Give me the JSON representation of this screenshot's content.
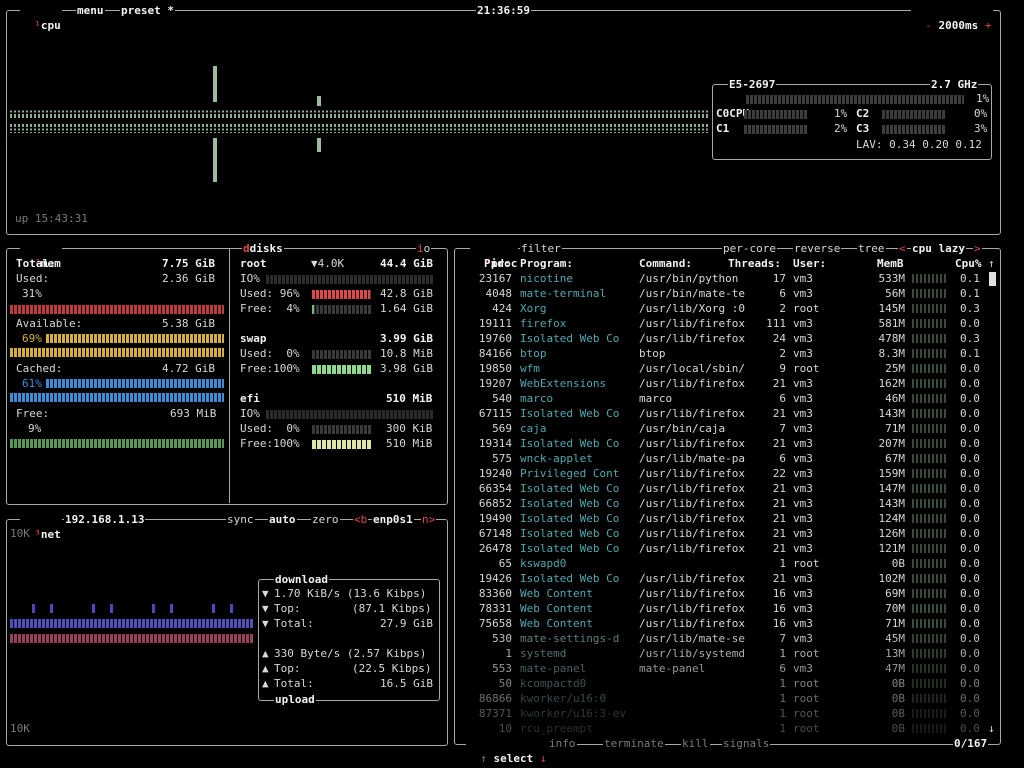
{
  "cpu_panel": {
    "tab_num": "¹",
    "label": "cpu",
    "menu": "menu",
    "preset": "preset *",
    "clock": "21:36:59",
    "interval": "2000ms",
    "minus": "-",
    "plus": "+",
    "uptime": "up 15:43:31",
    "model": "E5-2697",
    "freq": "2.7 GHz",
    "cpu_label": "CPU",
    "cpu_pct": "1%",
    "cores": [
      {
        "name": "C0",
        "pct": "1%"
      },
      {
        "name": "C2",
        "pct": "0%"
      },
      {
        "name": "C1",
        "pct": "2%"
      },
      {
        "name": "C3",
        "pct": "3%"
      }
    ],
    "load_avg": "LAV: 0.34 0.20 0.12"
  },
  "mem_panel": {
    "tab_num": "²",
    "label": "mem",
    "total_label": "Total:",
    "total_value": "7.75 GiB",
    "used_label": "Used:",
    "used_value": "2.36 GiB",
    "used_pct": "31%",
    "avail_label": "Available:",
    "avail_value": "5.38 GiB",
    "avail_pct": "69%",
    "cached_label": "Cached:",
    "cached_value": "4.72 GiB",
    "cached_pct": "61%",
    "free_label": "Free:",
    "free_value": "693 MiB",
    "free_pct": "9%",
    "colors": {
      "used": "#e04848",
      "available": "#d8b040",
      "cached": "#3c8ed8",
      "free": "#6cbf6c"
    }
  },
  "disks_panel": {
    "label": "disks",
    "io_label": "io",
    "disks": [
      {
        "name": "root",
        "io_rate": "▼4.0K",
        "size": "44.4 GiB",
        "io_line": "IO%",
        "used_line": "Used: 96%",
        "used_value": "42.8 GiB",
        "used_fraction": 0.96,
        "free_line": "Free:  4%",
        "free_value": "1.64 GiB",
        "free_fraction": 0.04
      },
      {
        "name": "swap",
        "size": "3.99 GiB",
        "used_line": "Used:  0%",
        "used_value": "10.8 MiB",
        "used_fraction": 0.0,
        "free_line": "Free:100%",
        "free_value": "3.98 GiB",
        "free_fraction": 1.0
      },
      {
        "name": "efi",
        "size": "510 MiB",
        "io_line": "IO%",
        "used_line": "Used:  0%",
        "used_value": "300 KiB",
        "used_fraction": 0.0,
        "free_line": "Free:100%",
        "free_value": "510 MiB",
        "free_fraction": 1.0
      }
    ]
  },
  "net_panel": {
    "tab_num": "³",
    "label": "net",
    "ip": "192.168.1.13",
    "sync": "sync",
    "auto": "auto",
    "zero": "zero",
    "prev": "<b",
    "iface": "enp0s1",
    "next": "n>",
    "scale_top": "10K",
    "scale_bottom": "10K",
    "download_title": "download",
    "upload_title": "upload",
    "download": [
      {
        "arrow": "▼",
        "label": "",
        "value": "1.70 KiB/s (13.6 Kibps)"
      },
      {
        "arrow": "▼",
        "label": "Top:",
        "value": "(87.1 Kibps)"
      },
      {
        "arrow": "▼",
        "label": "Total:",
        "value": "27.9 GiB"
      }
    ],
    "upload": [
      {
        "arrow": "▲",
        "label": "",
        "value": "330 Byte/s (2.57 Kibps)"
      },
      {
        "arrow": "▲",
        "label": "Top:",
        "value": "(22.5 Kibps)"
      },
      {
        "arrow": "▲",
        "label": "Total:",
        "value": "16.5 GiB"
      }
    ]
  },
  "proc_panel": {
    "tab_num": "⁴",
    "label": "proc",
    "filter": "filter",
    "per_core": "per-core",
    "reverse": "reverse",
    "tree": "tree",
    "sort_left": "<",
    "sort_by": "cpu lazy",
    "sort_right": ">",
    "headers": {
      "pid": "Pid:",
      "program": "Program:",
      "command": "Command:",
      "threads": "Threads:",
      "user": "User:",
      "mem": "MemB",
      "cpu": "Cpu%"
    },
    "select": "select",
    "info": "info",
    "terminate": "terminate",
    "kill": "kill",
    "signals": "signals",
    "count": "0/167",
    "rows": [
      {
        "pid": "23167",
        "program": "nicotine",
        "command": "/usr/bin/python",
        "threads": "17",
        "user": "vm3",
        "mem": "533M",
        "cpu": "0.1"
      },
      {
        "pid": "4048",
        "program": "mate-terminal",
        "command": "/usr/bin/mate-te",
        "threads": "6",
        "user": "vm3",
        "mem": "56M",
        "cpu": "0.1"
      },
      {
        "pid": "424",
        "program": "Xorg",
        "command": "/usr/lib/Xorg :0",
        "threads": "2",
        "user": "root",
        "mem": "145M",
        "cpu": "0.3"
      },
      {
        "pid": "19111",
        "program": "firefox",
        "command": "/usr/lib/firefox",
        "threads": "111",
        "user": "vm3",
        "mem": "581M",
        "cpu": "0.0"
      },
      {
        "pid": "19760",
        "program": "Isolated Web Co",
        "command": "/usr/lib/firefox",
        "threads": "24",
        "user": "vm3",
        "mem": "478M",
        "cpu": "0.3"
      },
      {
        "pid": "84166",
        "program": "btop",
        "command": "btop",
        "threads": "2",
        "user": "vm3",
        "mem": "8.3M",
        "cpu": "0.1"
      },
      {
        "pid": "19850",
        "program": "wfm",
        "command": "/usr/local/sbin/",
        "threads": "9",
        "user": "root",
        "mem": "25M",
        "cpu": "0.0"
      },
      {
        "pid": "19207",
        "program": "WebExtensions",
        "command": "/usr/lib/firefox",
        "threads": "21",
        "user": "vm3",
        "mem": "162M",
        "cpu": "0.0"
      },
      {
        "pid": "540",
        "program": "marco",
        "command": "marco",
        "threads": "6",
        "user": "vm3",
        "mem": "46M",
        "cpu": "0.0"
      },
      {
        "pid": "67115",
        "program": "Isolated Web Co",
        "command": "/usr/lib/firefox",
        "threads": "21",
        "user": "vm3",
        "mem": "143M",
        "cpu": "0.0"
      },
      {
        "pid": "569",
        "program": "caja",
        "command": "/usr/bin/caja",
        "threads": "7",
        "user": "vm3",
        "mem": "71M",
        "cpu": "0.0"
      },
      {
        "pid": "19314",
        "program": "Isolated Web Co",
        "command": "/usr/lib/firefox",
        "threads": "21",
        "user": "vm3",
        "mem": "207M",
        "cpu": "0.0"
      },
      {
        "pid": "575",
        "program": "wnck-applet",
        "command": "/usr/lib/mate-pa",
        "threads": "6",
        "user": "vm3",
        "mem": "67M",
        "cpu": "0.0"
      },
      {
        "pid": "19240",
        "program": "Privileged Cont",
        "command": "/usr/lib/firefox",
        "threads": "22",
        "user": "vm3",
        "mem": "159M",
        "cpu": "0.0"
      },
      {
        "pid": "66354",
        "program": "Isolated Web Co",
        "command": "/usr/lib/firefox",
        "threads": "21",
        "user": "vm3",
        "mem": "147M",
        "cpu": "0.0"
      },
      {
        "pid": "66852",
        "program": "Isolated Web Co",
        "command": "/usr/lib/firefox",
        "threads": "21",
        "user": "vm3",
        "mem": "143M",
        "cpu": "0.0"
      },
      {
        "pid": "19490",
        "program": "Isolated Web Co",
        "command": "/usr/lib/firefox",
        "threads": "21",
        "user": "vm3",
        "mem": "124M",
        "cpu": "0.0"
      },
      {
        "pid": "67148",
        "program": "Isolated Web Co",
        "command": "/usr/lib/firefox",
        "threads": "21",
        "user": "vm3",
        "mem": "126M",
        "cpu": "0.0"
      },
      {
        "pid": "26478",
        "program": "Isolated Web Co",
        "command": "/usr/lib/firefox",
        "threads": "21",
        "user": "vm3",
        "mem": "121M",
        "cpu": "0.0"
      },
      {
        "pid": "65",
        "program": "kswapd0",
        "command": "",
        "threads": "1",
        "user": "root",
        "mem": "0B",
        "cpu": "0.0"
      },
      {
        "pid": "19426",
        "program": "Isolated Web Co",
        "command": "/usr/lib/firefox",
        "threads": "21",
        "user": "vm3",
        "mem": "102M",
        "cpu": "0.0"
      },
      {
        "pid": "83360",
        "program": "Web Content",
        "command": "/usr/lib/firefox",
        "threads": "16",
        "user": "vm3",
        "mem": "69M",
        "cpu": "0.0"
      },
      {
        "pid": "78331",
        "program": "Web Content",
        "command": "/usr/lib/firefox",
        "threads": "16",
        "user": "vm3",
        "mem": "70M",
        "cpu": "0.0"
      },
      {
        "pid": "75658",
        "program": "Web Content",
        "command": "/usr/lib/firefox",
        "threads": "16",
        "user": "vm3",
        "mem": "71M",
        "cpu": "0.0"
      },
      {
        "pid": "530",
        "program": "mate-settings-d",
        "command": "/usr/lib/mate-se",
        "threads": "7",
        "user": "vm3",
        "mem": "45M",
        "cpu": "0.0"
      },
      {
        "pid": "1",
        "program": "systemd",
        "command": "/usr/lib/systemd",
        "threads": "1",
        "user": "root",
        "mem": "13M",
        "cpu": "0.0"
      },
      {
        "pid": "553",
        "program": "mate-panel",
        "command": "mate-panel",
        "threads": "6",
        "user": "vm3",
        "mem": "47M",
        "cpu": "0.0"
      },
      {
        "pid": "50",
        "program": "kcompactd0",
        "command": "",
        "threads": "1",
        "user": "root",
        "mem": "0B",
        "cpu": "0.0"
      },
      {
        "pid": "86866",
        "program": "kworker/u16:0",
        "command": "",
        "threads": "1",
        "user": "root",
        "mem": "0B",
        "cpu": "0.0"
      },
      {
        "pid": "87371",
        "program": "kworker/u16:3-ev",
        "command": "",
        "threads": "1",
        "user": "root",
        "mem": "0B",
        "cpu": "0.0"
      },
      {
        "pid": "10",
        "program": "rcu_preempt",
        "command": "",
        "threads": "1",
        "user": "root",
        "mem": "0B",
        "cpu": "0.0"
      }
    ]
  }
}
